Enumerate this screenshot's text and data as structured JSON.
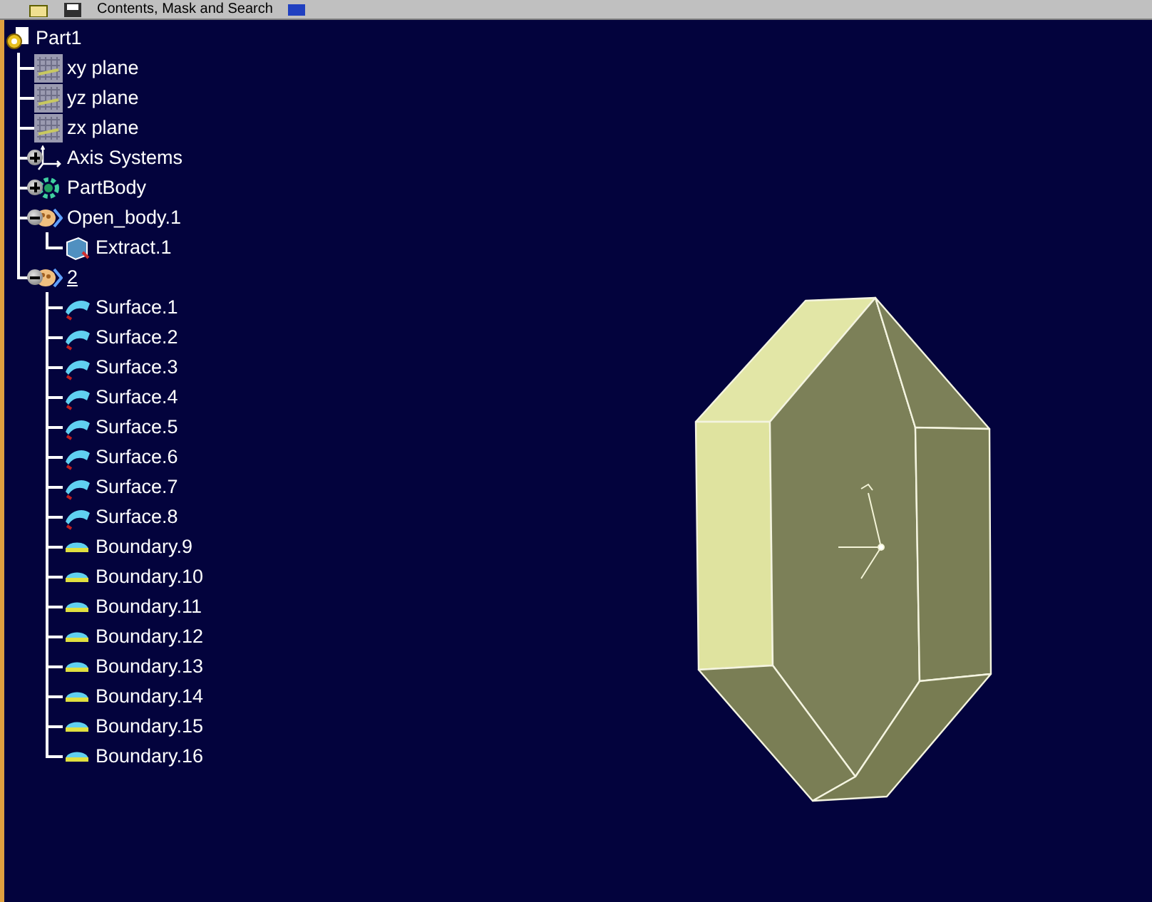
{
  "toolbar": {
    "label": "Contents, Mask and Search"
  },
  "tree": {
    "label": "Part1",
    "kind": "part",
    "children": [
      {
        "label": "xy plane",
        "kind": "plane"
      },
      {
        "label": "yz plane",
        "kind": "plane"
      },
      {
        "label": "zx plane",
        "kind": "plane"
      },
      {
        "label": "Axis Systems",
        "kind": "axis",
        "expanded": false
      },
      {
        "label": "PartBody",
        "kind": "body",
        "expanded": false
      },
      {
        "label": "Open_body.1",
        "kind": "geoset",
        "expanded": true,
        "current": false,
        "children": [
          {
            "label": "Extract.1",
            "kind": "extract"
          }
        ]
      },
      {
        "label": "2",
        "kind": "geoset",
        "expanded": true,
        "current": true,
        "children": [
          {
            "label": "Surface.1",
            "kind": "surface"
          },
          {
            "label": "Surface.2",
            "kind": "surface"
          },
          {
            "label": "Surface.3",
            "kind": "surface"
          },
          {
            "label": "Surface.4",
            "kind": "surface"
          },
          {
            "label": "Surface.5",
            "kind": "surface"
          },
          {
            "label": "Surface.6",
            "kind": "surface"
          },
          {
            "label": "Surface.7",
            "kind": "surface"
          },
          {
            "label": "Surface.8",
            "kind": "surface"
          },
          {
            "label": "Boundary.9",
            "kind": "boundary"
          },
          {
            "label": "Boundary.10",
            "kind": "boundary"
          },
          {
            "label": "Boundary.11",
            "kind": "boundary"
          },
          {
            "label": "Boundary.12",
            "kind": "boundary"
          },
          {
            "label": "Boundary.13",
            "kind": "boundary"
          },
          {
            "label": "Boundary.14",
            "kind": "boundary"
          },
          {
            "label": "Boundary.15",
            "kind": "boundary"
          },
          {
            "label": "Boundary.16",
            "kind": "boundary"
          }
        ]
      }
    ]
  }
}
